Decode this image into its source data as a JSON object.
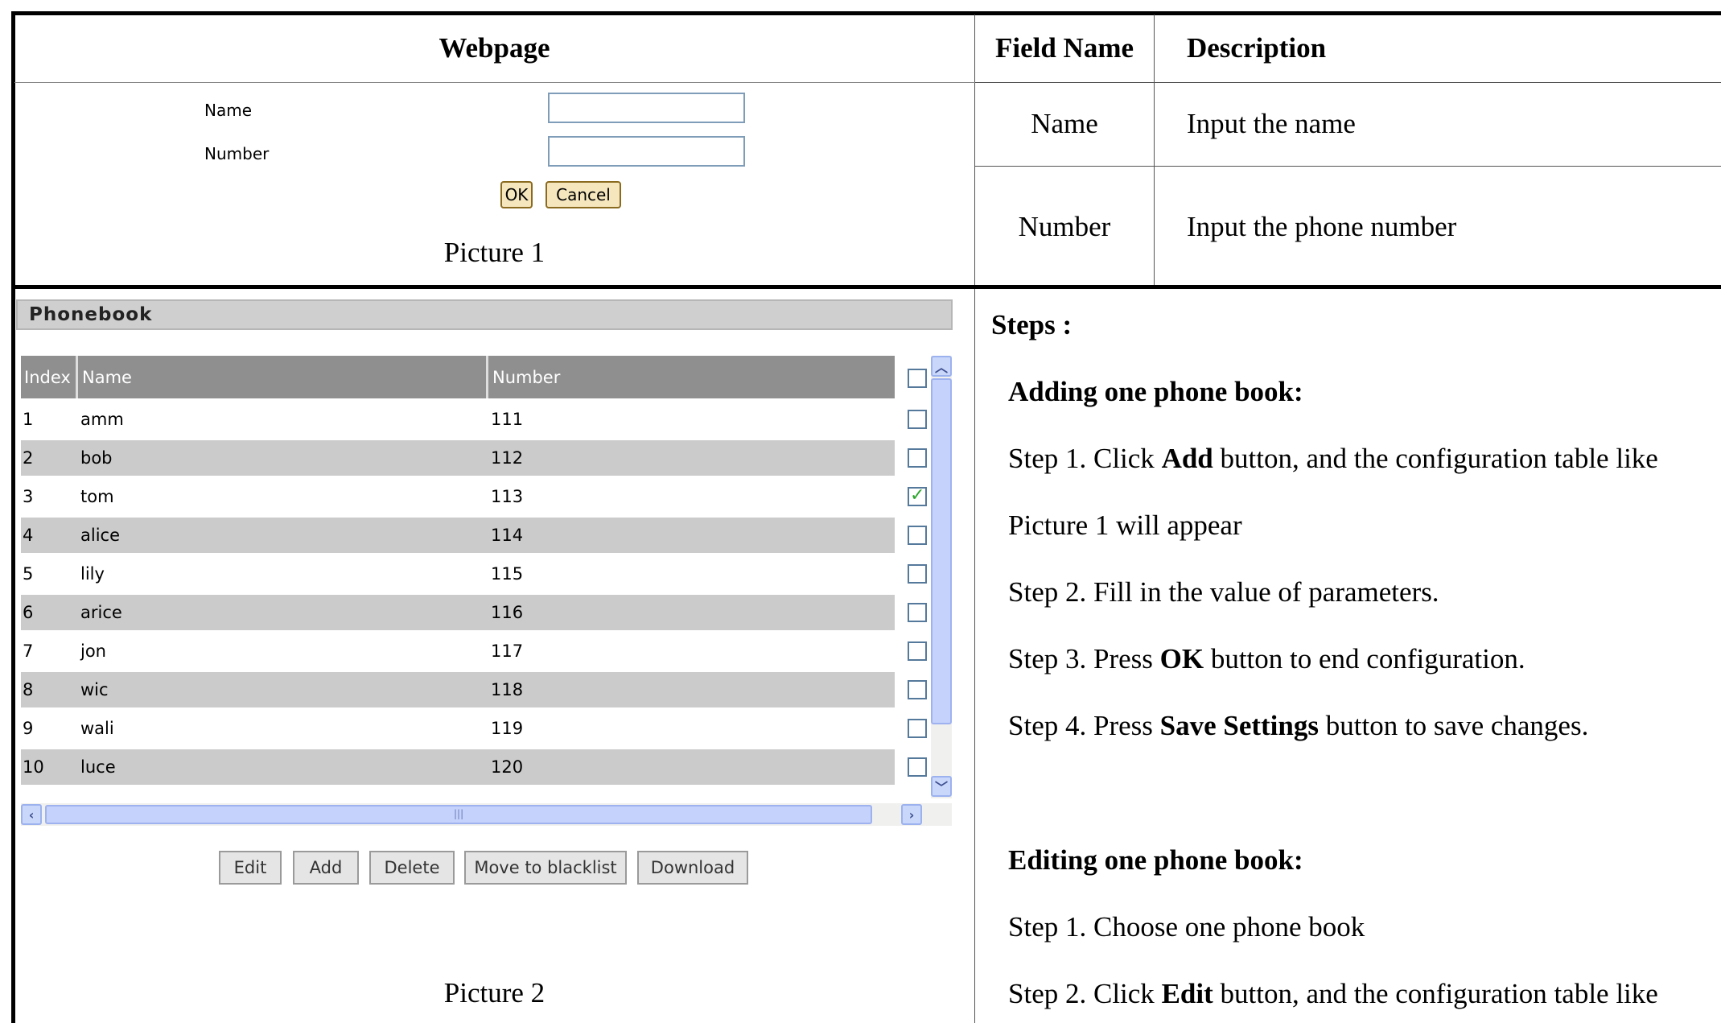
{
  "table_header": {
    "webpage": "Webpage",
    "field_name": "Field Name",
    "description": "Description"
  },
  "fields": [
    {
      "name": "Name",
      "description": "Input the name"
    },
    {
      "name": "Number",
      "description": "Input the phone number"
    }
  ],
  "picture1": {
    "name_label": "Name",
    "number_label": "Number",
    "name_value": "",
    "number_value": "",
    "ok_label": "OK",
    "cancel_label": "Cancel",
    "caption": "Picture 1"
  },
  "picture2": {
    "title": "Phonebook",
    "columns": {
      "index": "Index",
      "name": "Name",
      "number": "Number"
    },
    "rows": [
      {
        "index": "1",
        "name": "amm",
        "number": "111",
        "checked": false
      },
      {
        "index": "2",
        "name": "bob",
        "number": "112",
        "checked": false
      },
      {
        "index": "3",
        "name": "tom",
        "number": "113",
        "checked": true
      },
      {
        "index": "4",
        "name": "alice",
        "number": "114",
        "checked": false
      },
      {
        "index": "5",
        "name": "lily",
        "number": "115",
        "checked": false
      },
      {
        "index": "6",
        "name": "arice",
        "number": "116",
        "checked": false
      },
      {
        "index": "7",
        "name": "jon",
        "number": "117",
        "checked": false
      },
      {
        "index": "8",
        "name": "wic",
        "number": "118",
        "checked": false
      },
      {
        "index": "9",
        "name": "wali",
        "number": "119",
        "checked": false
      },
      {
        "index": "10",
        "name": "luce",
        "number": "120",
        "checked": false
      }
    ],
    "buttons": {
      "edit": "Edit",
      "add": "Add",
      "delete": "Delete",
      "blacklist": "Move to blacklist",
      "download": "Download"
    },
    "caption": "Picture 2"
  },
  "steps": {
    "title": "Steps :",
    "adding_heading": "Adding one phone book:",
    "add_step1_pre": "Step 1. Click ",
    "add_step1_bold": "Add",
    "add_step1_post": " button, and the configuration table like",
    "add_step1_cont": "Picture 1 will appear",
    "add_step2": "Step 2. Fill in the value of parameters.",
    "add_step3_pre": "Step 3. Press ",
    "add_step3_bold": "OK",
    "add_step3_post": " button to end configuration.",
    "add_step4_pre": "Step 4. Press ",
    "add_step4_bold": "Save Settings",
    "add_step4_post": " button to save changes.",
    "editing_heading": "Editing one phone book:",
    "edit_step1": "Step 1. Choose one phone book",
    "edit_step2_pre": "Step 2. Click ",
    "edit_step2_bold": "Edit",
    "edit_step2_post": " button, and the configuration table like"
  },
  "icons": {
    "check": "check-icon",
    "scroll_up": "chevron-up-icon",
    "scroll_down": "chevron-down-icon",
    "scroll_left": "chevron-left-icon",
    "scroll_right": "chevron-right-icon"
  }
}
